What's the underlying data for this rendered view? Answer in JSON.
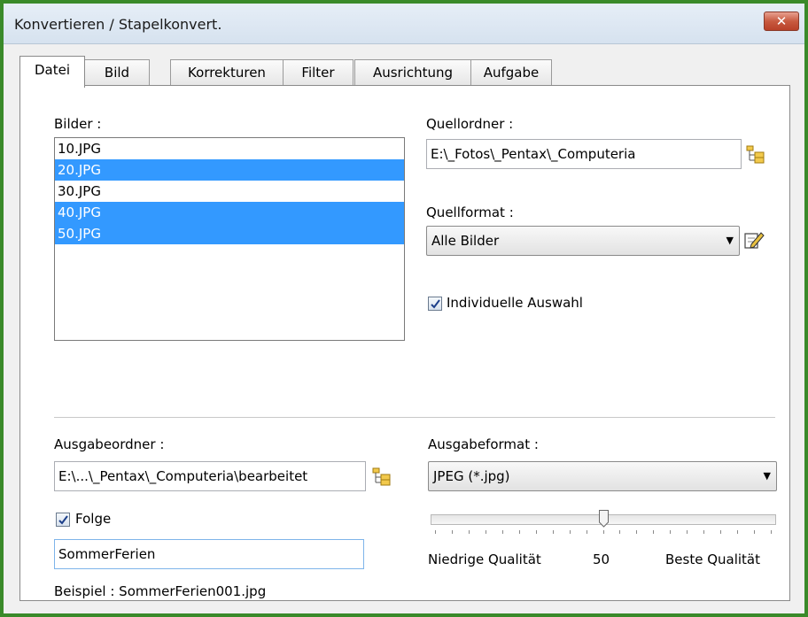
{
  "window": {
    "title": "Konvertieren / Stapelkonvert.",
    "close_label": "✕"
  },
  "tabs": [
    {
      "label": "Datei",
      "active": true
    },
    {
      "label": "Bild"
    },
    {
      "label": "Korrekturen"
    },
    {
      "label": "Filter"
    },
    {
      "label": "Ausrichtung"
    },
    {
      "label": "Aufgabe"
    }
  ],
  "images": {
    "label": "Bilder :",
    "items": [
      {
        "name": "10.JPG",
        "selected": false
      },
      {
        "name": "20.JPG",
        "selected": true
      },
      {
        "name": "30.JPG",
        "selected": false
      },
      {
        "name": "40.JPG",
        "selected": true
      },
      {
        "name": "50.JPG",
        "selected": true
      }
    ]
  },
  "source_folder": {
    "label": "Quellordner :",
    "value": "E:\\_Fotos\\_Pentax\\_Computeria"
  },
  "source_format": {
    "label": "Quellformat :",
    "value": "Alle Bilder"
  },
  "individual_selection": {
    "label": "Individuelle Auswahl",
    "checked": true
  },
  "output_folder": {
    "label": "Ausgabeordner :",
    "value": "E:\\...\\_Pentax\\_Computeria\\bearbeitet"
  },
  "output_format": {
    "label": "Ausgabeformat :",
    "value": "JPEG (*.jpg)"
  },
  "sequence": {
    "label": "Folge",
    "checked": true,
    "value": "SommerFerien",
    "example": "Beispiel : SommerFerien001.jpg"
  },
  "quality": {
    "min_label": "Niedrige Qualität",
    "value": "50",
    "max_label": "Beste Qualität",
    "fraction": 0.5
  },
  "colors": {
    "selection": "#3399ff",
    "frame": "#3a8a2a",
    "close": "#c85a40"
  }
}
